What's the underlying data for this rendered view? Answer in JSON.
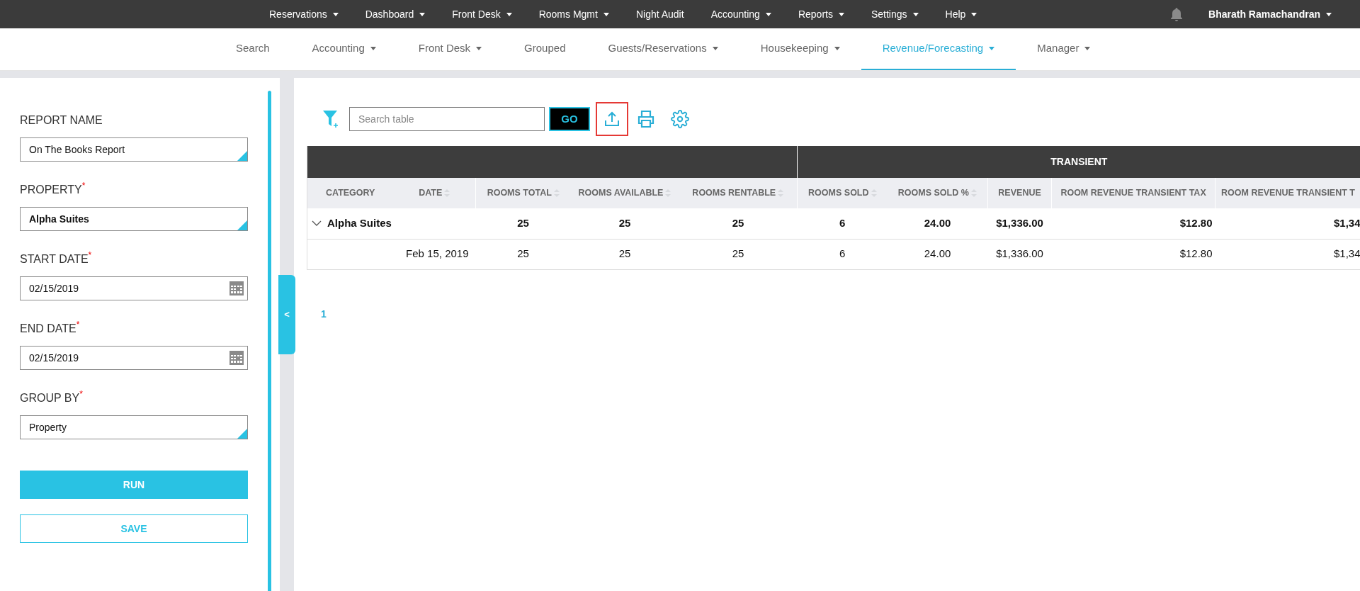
{
  "top_nav": {
    "items": [
      {
        "label": "Reservations",
        "has_menu": true
      },
      {
        "label": "Dashboard",
        "has_menu": true
      },
      {
        "label": "Front Desk",
        "has_menu": true
      },
      {
        "label": "Rooms Mgmt",
        "has_menu": true
      },
      {
        "label": "Night Audit",
        "has_menu": false
      },
      {
        "label": "Accounting",
        "has_menu": true
      },
      {
        "label": "Reports",
        "has_menu": true
      },
      {
        "label": "Settings",
        "has_menu": true
      },
      {
        "label": "Help",
        "has_menu": true
      }
    ],
    "user": {
      "name": "Bharath Ramachandran",
      "has_menu": true
    }
  },
  "sub_nav": {
    "items": [
      {
        "label": "Search",
        "has_menu": false,
        "selected": false
      },
      {
        "label": "Accounting",
        "has_menu": true,
        "selected": false
      },
      {
        "label": "Front Desk",
        "has_menu": true,
        "selected": false
      },
      {
        "label": "Grouped",
        "has_menu": false,
        "selected": false
      },
      {
        "label": "Guests/Reservations",
        "has_menu": true,
        "selected": false
      },
      {
        "label": "Housekeeping",
        "has_menu": true,
        "selected": false
      },
      {
        "label": "Revenue/Forecasting",
        "has_menu": true,
        "selected": true
      },
      {
        "label": "Manager",
        "has_menu": true,
        "selected": false
      }
    ]
  },
  "report_form": {
    "fields": [
      {
        "label": "REPORT NAME",
        "kind": "select",
        "value": "On The Books Report"
      },
      {
        "label": "PROPERTY",
        "required_mark": "*",
        "kind": "select",
        "value": "Alpha Suites"
      },
      {
        "label": "START DATE",
        "required_mark": "*",
        "kind": "date",
        "value": "02/15/2019"
      },
      {
        "label": "END DATE",
        "required_mark": "*",
        "kind": "date",
        "value": "02/15/2019"
      },
      {
        "label": "GROUP BY",
        "required_mark": "*",
        "kind": "select",
        "value": "Property"
      }
    ],
    "buttons": [
      {
        "label": "RUN",
        "kind": "primary"
      },
      {
        "label": "SAVE",
        "kind": "secondary"
      }
    ]
  },
  "panel_toggle": "<",
  "toolbar": {
    "search": {
      "placeholder": "Search table"
    },
    "go_button": "GO",
    "tools": [
      {
        "kind": "export",
        "highlighted": true
      },
      {
        "kind": "print",
        "highlighted": false
      },
      {
        "kind": "settings",
        "highlighted": false
      }
    ]
  },
  "table": {
    "group_headers": [
      {
        "label": "TRANSIENT"
      }
    ],
    "columns": [
      {
        "label": "CATEGORY",
        "sortable": false
      },
      {
        "label": "DATE",
        "sortable": true
      },
      {
        "label": "ROOMS TOTAL",
        "sortable": true
      },
      {
        "label": "ROOMS AVAILABLE",
        "sortable": true
      },
      {
        "label": "ROOMS RENTABLE",
        "sortable": true
      },
      {
        "label": "ROOMS SOLD",
        "sortable": true
      },
      {
        "label": "ROOMS SOLD %",
        "sortable": true
      },
      {
        "label": "REVENUE",
        "sortable": false
      },
      {
        "label": "ROOM REVENUE TRANSIENT TAX",
        "sortable": false
      },
      {
        "label": "ROOM REVENUE TRANSIENT T",
        "sortable": false
      }
    ],
    "rows": [
      {
        "kind": "group",
        "expanded": true,
        "label": "Alpha Suites",
        "values": [
          "25",
          "25",
          "25",
          "6",
          "24.00",
          "$1,336.00",
          "$12.80",
          "$1,34"
        ]
      },
      {
        "kind": "detail",
        "date": "Feb 15, 2019",
        "values": [
          "25",
          "25",
          "25",
          "6",
          "24.00",
          "$1,336.00",
          "$12.80",
          "$1,34"
        ]
      }
    ]
  },
  "pagination": {
    "pages": [
      {
        "label": "1",
        "selected": true
      }
    ]
  }
}
